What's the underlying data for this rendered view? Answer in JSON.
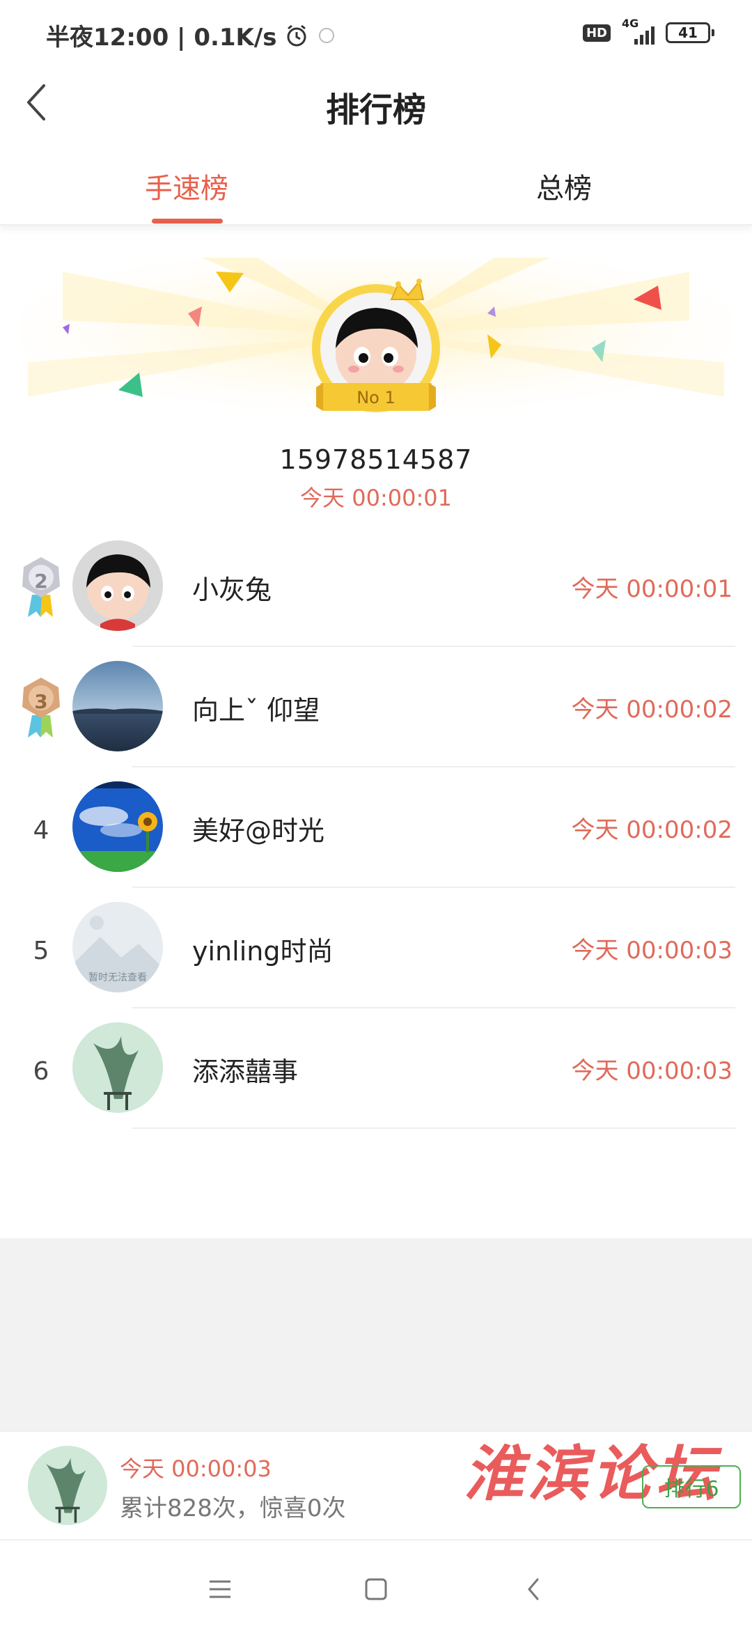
{
  "status_bar": {
    "time_label": "半夜12:00 | 0.1K/s",
    "hd": "HD",
    "network": "4G",
    "battery": "41"
  },
  "header": {
    "title": "排行榜"
  },
  "tabs": [
    {
      "label": "手速榜",
      "active": true
    },
    {
      "label": "总榜",
      "active": false
    }
  ],
  "top_rank": {
    "badge": "No 1",
    "name": "15978514587",
    "time": "今天 00:00:01"
  },
  "ranks": [
    {
      "rank": "2",
      "name": "小灰兔",
      "time": "今天 00:00:01"
    },
    {
      "rank": "3",
      "name": "向上ˇ 仰望",
      "time": "今天 00:00:02"
    },
    {
      "rank": "4",
      "name": "美好@时光",
      "time": "今天 00:00:02"
    },
    {
      "rank": "5",
      "name": "yinling时尚",
      "time": "今天 00:00:03",
      "avatar_caption": "暂时无法查看"
    },
    {
      "rank": "6",
      "name": "添添囍事",
      "time": "今天 00:00:03"
    }
  ],
  "me": {
    "time": "今天 00:00:03",
    "stats": "累计828次，惊喜0次",
    "rank_button": "排行6"
  },
  "watermark": "淮滨论坛"
}
